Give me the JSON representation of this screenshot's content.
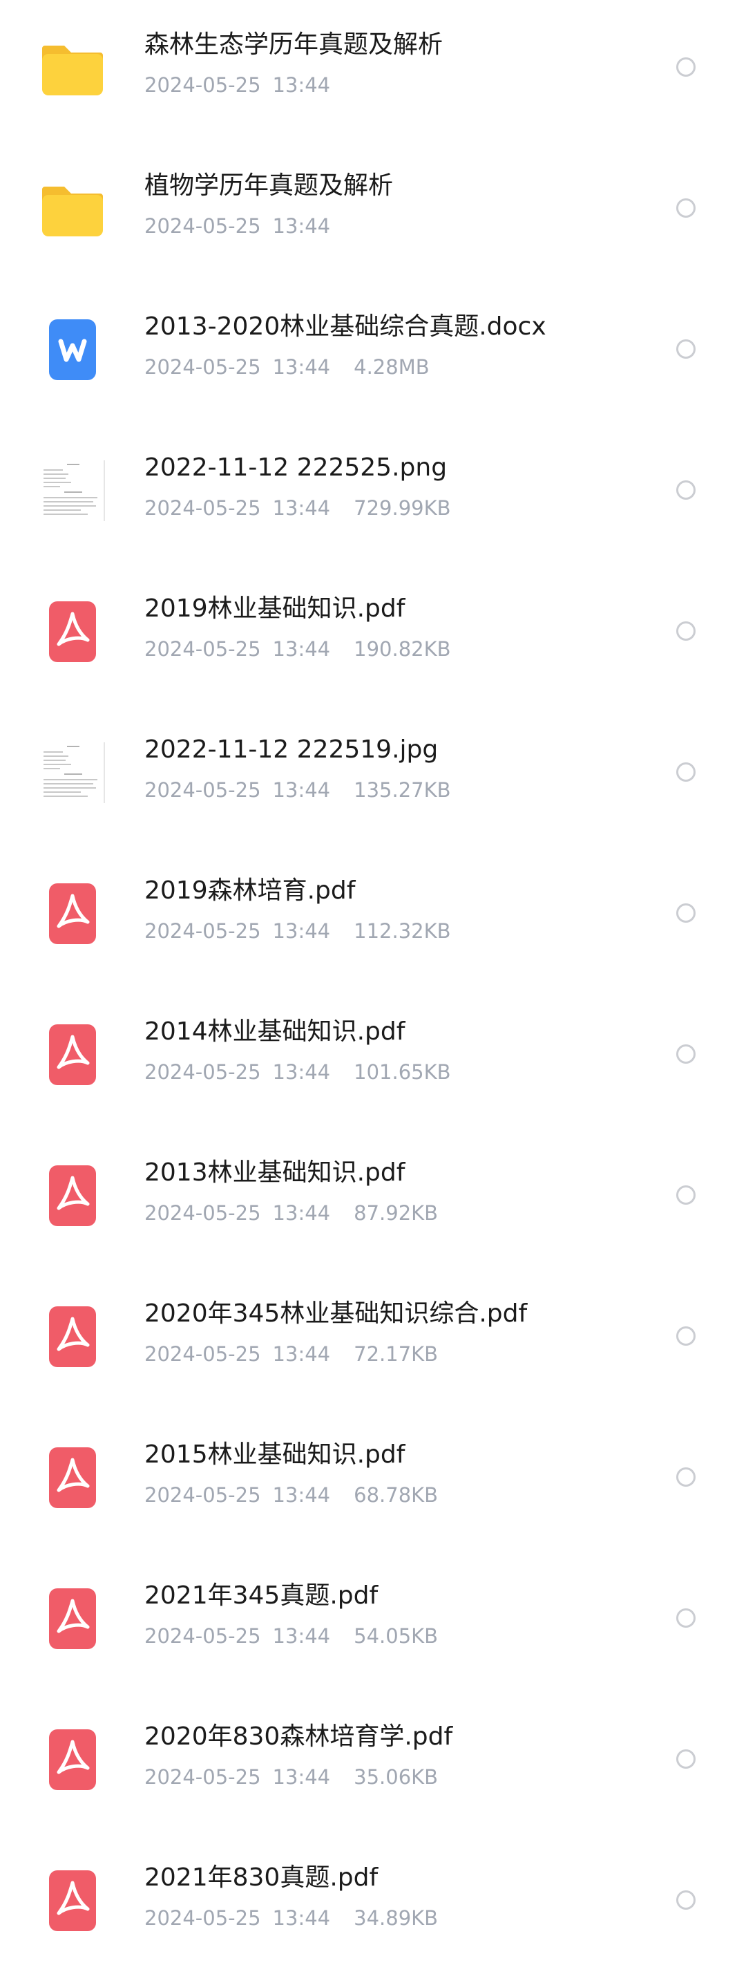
{
  "files": [
    {
      "name": "森林生态学历年真题及解析",
      "date": "2024-05-25",
      "time": "13:44",
      "size": "",
      "icon": "folder-icon"
    },
    {
      "name": "植物学历年真题及解析",
      "date": "2024-05-25",
      "time": "13:44",
      "size": "",
      "icon": "folder-icon"
    },
    {
      "name": "2013-2020林业基础综合真题.docx",
      "date": "2024-05-25",
      "time": "13:44",
      "size": "4.28MB",
      "icon": "word-icon"
    },
    {
      "name": "2022-11-12 222525.png",
      "date": "2024-05-25",
      "time": "13:44",
      "size": "729.99KB",
      "icon": "image-thumbnail"
    },
    {
      "name": "2019林业基础知识.pdf",
      "date": "2024-05-25",
      "time": "13:44",
      "size": "190.82KB",
      "icon": "pdf-icon"
    },
    {
      "name": "2022-11-12 222519.jpg",
      "date": "2024-05-25",
      "time": "13:44",
      "size": "135.27KB",
      "icon": "image-thumbnail"
    },
    {
      "name": "2019森林培育.pdf",
      "date": "2024-05-25",
      "time": "13:44",
      "size": "112.32KB",
      "icon": "pdf-icon"
    },
    {
      "name": "2014林业基础知识.pdf",
      "date": "2024-05-25",
      "time": "13:44",
      "size": "101.65KB",
      "icon": "pdf-icon"
    },
    {
      "name": "2013林业基础知识.pdf",
      "date": "2024-05-25",
      "time": "13:44",
      "size": "87.92KB",
      "icon": "pdf-icon"
    },
    {
      "name": "2020年345林业基础知识综合.pdf",
      "date": "2024-05-25",
      "time": "13:44",
      "size": "72.17KB",
      "icon": "pdf-icon"
    },
    {
      "name": "2015林业基础知识.pdf",
      "date": "2024-05-25",
      "time": "13:44",
      "size": "68.78KB",
      "icon": "pdf-icon"
    },
    {
      "name": "2021年345真题.pdf",
      "date": "2024-05-25",
      "time": "13:44",
      "size": "54.05KB",
      "icon": "pdf-icon"
    },
    {
      "name": "2020年830森林培育学.pdf",
      "date": "2024-05-25",
      "time": "13:44",
      "size": "35.06KB",
      "icon": "pdf-icon"
    },
    {
      "name": "2021年830真题.pdf",
      "date": "2024-05-25",
      "time": "13:44",
      "size": "34.89KB",
      "icon": "pdf-icon"
    }
  ],
  "colors": {
    "folder": "#fdd23d",
    "word": "#3f8cf7",
    "pdf": "#f05c68",
    "meta_text": "#a1a7b2",
    "name_text": "#1b1b1b",
    "select_ring": "#cbcdd2"
  }
}
